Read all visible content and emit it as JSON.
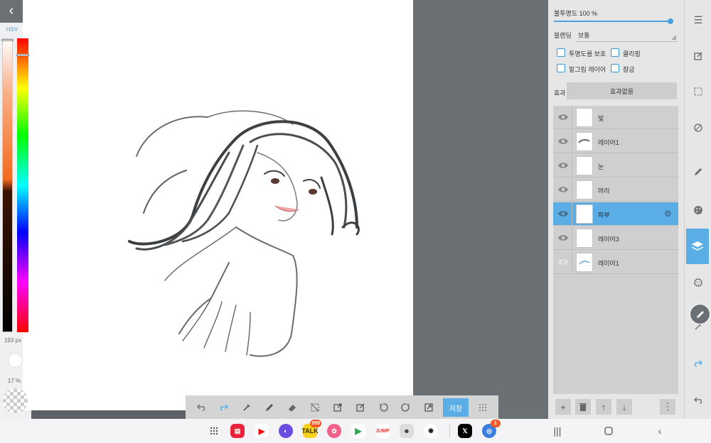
{
  "left_panel": {
    "color_mode_label": "HSV",
    "brush_size": "193 px",
    "opacity": "17 %"
  },
  "toolbar": {
    "save_label": "저장"
  },
  "layer_panel": {
    "opacity_label": "불투명도 100 %",
    "opacity_value": 1.0,
    "blending_label": "블렌딩",
    "blending_value": "보통",
    "checkbox_protect": "투명도를 보호",
    "checkbox_clipping": "클리핑",
    "checkbox_underdrawing": "밑그림 레이어",
    "checkbox_lock": "잠금",
    "effect_label": "효과",
    "effect_value": "효과없음",
    "layers": [
      {
        "name": "빛",
        "visible": true,
        "selected": false
      },
      {
        "name": "레이어1",
        "visible": true,
        "selected": false
      },
      {
        "name": "눈",
        "visible": true,
        "selected": false
      },
      {
        "name": "머리",
        "visible": true,
        "selected": false
      },
      {
        "name": "피부",
        "visible": true,
        "selected": true
      },
      {
        "name": "레이어3",
        "visible": true,
        "selected": false
      },
      {
        "name": "레이어1",
        "visible": false,
        "selected": false
      }
    ]
  },
  "system_bar": {
    "kakao_badge": "999",
    "browser_badge": "1",
    "jump_label": "JUMP"
  },
  "colors": {
    "accent": "#5aaee5",
    "checkbox": "#3a95d6"
  }
}
